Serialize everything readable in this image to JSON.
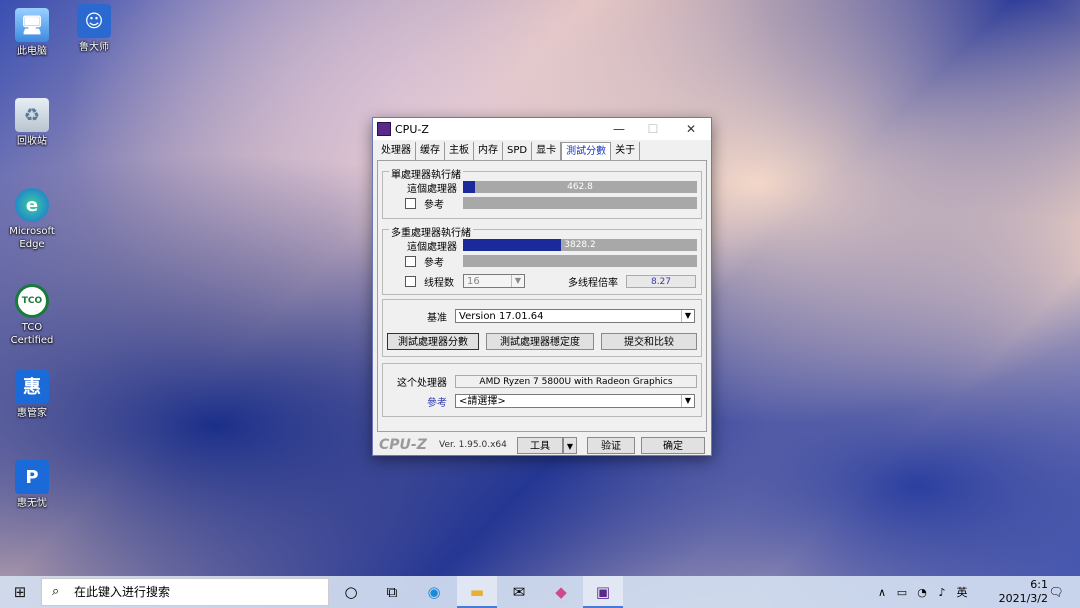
{
  "desktop": {
    "icons": [
      {
        "label": "此电脑"
      },
      {
        "label": "鲁大师"
      },
      {
        "label": "回收站"
      },
      {
        "label": "Microsoft Edge"
      },
      {
        "label": "TCO Certified"
      },
      {
        "label": "惠管家"
      },
      {
        "label": "惠无忧"
      }
    ]
  },
  "window": {
    "title": "CPU-Z",
    "tabs": [
      "处理器",
      "缓存",
      "主板",
      "内存",
      "SPD",
      "显卡",
      "測試分數",
      "关于"
    ],
    "active_tab_index": 6,
    "single": {
      "title": "單處理器執行緒",
      "this_label": "這個處理器",
      "ref_label": "參考",
      "score": "462.8",
      "fill_fraction": 0.05
    },
    "multi": {
      "title": "多重處理器執行緒",
      "this_label": "這個處理器",
      "ref_label": "參考",
      "score": "3828.2",
      "fill_fraction": 0.42,
      "threads_label": "线程数",
      "threads_value": "16",
      "ratio_label": "多线程倍率",
      "ratio_value": "8.27"
    },
    "bench": {
      "base_label": "基准",
      "base_value": "Version 17.01.64",
      "btn_bench": "測試處理器分數",
      "btn_stress": "測試處理器穩定度",
      "btn_submit": "提交和比较"
    },
    "proc": {
      "this_label": "这个处理器",
      "this_value": "AMD Ryzen 7 5800U with Radeon Graphics",
      "ref_label": "參考",
      "ref_value": "<請選擇>"
    },
    "footer": {
      "logo": "CPU-Z",
      "version": "Ver. 1.95.0.x64",
      "tools": "工具",
      "validate": "验证",
      "ok": "确定"
    }
  },
  "taskbar": {
    "search_placeholder": "在此键入进行搜索",
    "ime": "英",
    "time": "6:1",
    "date": "2021/3/2"
  }
}
